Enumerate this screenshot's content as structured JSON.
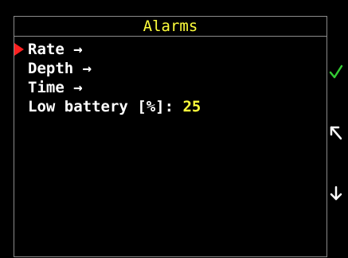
{
  "header": {
    "title": "Alarms"
  },
  "menu": {
    "items": [
      {
        "label": "Rate →",
        "selected": true
      },
      {
        "label": "Depth →",
        "selected": false
      },
      {
        "label": "Time →",
        "selected": false
      },
      {
        "label": "Low battery [%]: ",
        "value": "25",
        "selected": false
      }
    ]
  },
  "side_buttons": {
    "icons": [
      "checkmark-icon",
      "up-left-arrow-icon",
      "down-arrow-icon"
    ]
  },
  "colors": {
    "title": "#ffff3c",
    "value": "#ffff3c",
    "text": "#ffffff",
    "cursor": "#ff2020",
    "check": "#33cc33",
    "border": "#8a8a8a",
    "background": "#000000"
  }
}
